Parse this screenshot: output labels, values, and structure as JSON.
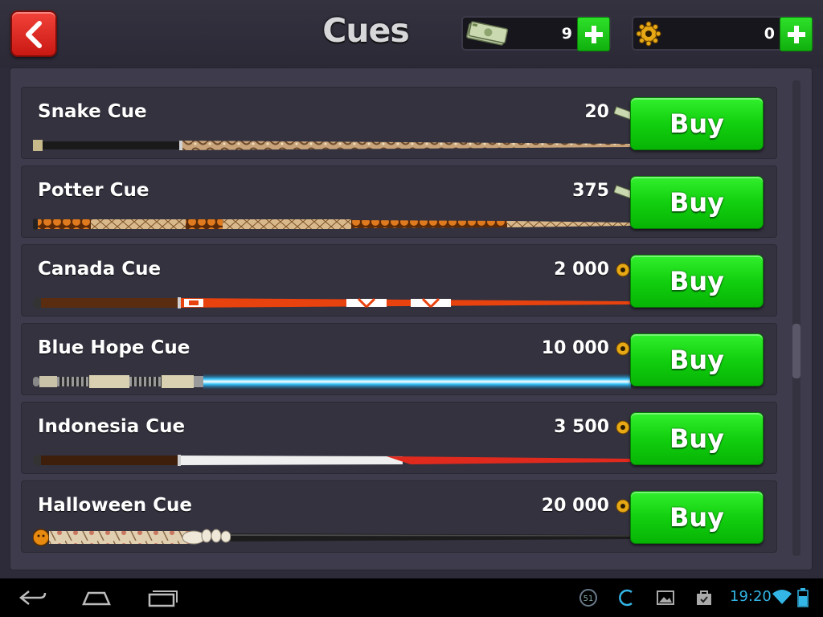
{
  "header": {
    "title": "Cues",
    "back_label": "back",
    "cash": {
      "amount": "9",
      "icon": "money-icon"
    },
    "coins": {
      "amount": "0",
      "icon": "coin-icon"
    }
  },
  "cues": [
    {
      "name": "Snake Cue",
      "price": "20",
      "currency": "cash",
      "buy_label": "Buy"
    },
    {
      "name": "Potter Cue",
      "price": "375",
      "currency": "cash",
      "buy_label": "Buy"
    },
    {
      "name": "Canada Cue",
      "price": "2 000",
      "currency": "coins",
      "buy_label": "Buy"
    },
    {
      "name": "Blue Hope Cue",
      "price": "10 000",
      "currency": "coins",
      "buy_label": "Buy"
    },
    {
      "name": "Indonesia Cue",
      "price": "3 500",
      "currency": "coins",
      "buy_label": "Buy"
    },
    {
      "name": "Halloween Cue",
      "price": "20 000",
      "currency": "coins",
      "buy_label": "Buy"
    }
  ],
  "system_bar": {
    "time": "19:20",
    "notification_count": "51"
  },
  "colors": {
    "buy_green": "#12d00f",
    "back_red": "#e0231b",
    "status_blue": "#33b5e5"
  }
}
